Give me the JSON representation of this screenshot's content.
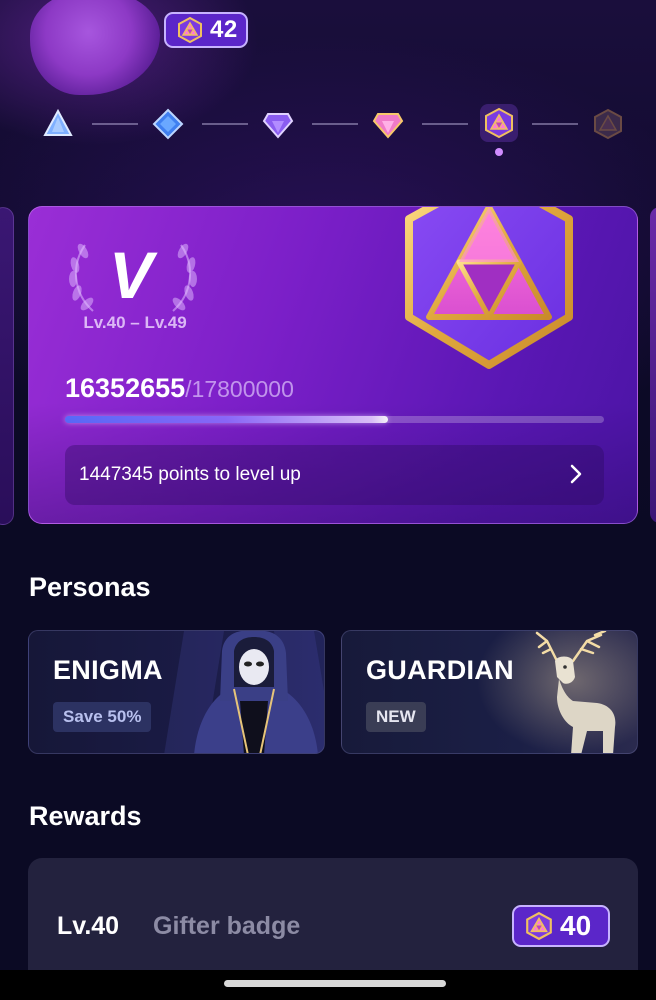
{
  "header": {
    "gem_count": "42"
  },
  "tiers": [
    {
      "name": "tier-1-gem-icon",
      "color": "#9fc7ff"
    },
    {
      "name": "tier-2-gem-icon",
      "color": "#6aa8ff"
    },
    {
      "name": "tier-3-gem-icon",
      "color": "#b28cff"
    },
    {
      "name": "tier-4-gem-icon",
      "color": "#ff8fd8"
    },
    {
      "name": "tier-5-gem-icon",
      "color": "#e0a84e",
      "active": true
    },
    {
      "name": "tier-6-gem-icon",
      "color": "#6a4a44"
    }
  ],
  "level_card": {
    "tier_numeral": "V",
    "level_range": "Lv.40 – Lv.49",
    "points_current": "16352655",
    "points_total": "/17800000",
    "progress_fraction": 0.6,
    "level_up_text": "1447345 points to level up"
  },
  "personas": {
    "title": "Personas",
    "items": [
      {
        "name": "ENIGMA",
        "tag": "Save 50%"
      },
      {
        "name": "GUARDIAN",
        "tag": "NEW"
      }
    ]
  },
  "rewards": {
    "title": "Rewards",
    "items": [
      {
        "level": "Lv.40",
        "name": "Gifter badge",
        "cost": "40"
      }
    ]
  },
  "colors": {
    "background": "#0b0a24",
    "accent": "#5b26c9",
    "gold": "#e0b24a",
    "card_purple": "#7b1fc8"
  }
}
